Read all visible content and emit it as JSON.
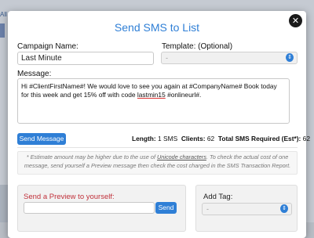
{
  "background": {
    "tab_text": "All"
  },
  "modal": {
    "title": "Send SMS to List",
    "close_icon": "close-icon"
  },
  "campaign": {
    "label": "Campaign Name:",
    "value": "Last Minute"
  },
  "template": {
    "label": "Template: (Optional)",
    "selected": "-"
  },
  "message": {
    "label": "Message:",
    "text_part1": "Hi #ClientFirstName#! We would love to see you again at #CompanyName# Book today for this week and get 15% off with code ",
    "code": "lastmin15",
    "text_part2": "  #onlineurl#."
  },
  "send_message_button": "Send Message",
  "stats": {
    "length_label": "Length:",
    "length_value": "1 SMS",
    "clients_label": "Clients:",
    "clients_value": "62",
    "total_label": "Total SMS Required (Est*):",
    "total_value": "62"
  },
  "note": {
    "part1": "* Estimate amount may be higher due to the use of ",
    "link": "Unicode characters",
    "part2": ". To check the actual cost of one message, send yourself a Preview message then check the cost charged in the SMS Transaction Report."
  },
  "preview": {
    "label": "Send a Preview to yourself:",
    "input_value": "",
    "send_button": "Send"
  },
  "add_tag": {
    "label": "Add Tag:",
    "selected": "-"
  },
  "colors": {
    "accent": "#2f7fd6",
    "preview_label": "#c0303a"
  }
}
